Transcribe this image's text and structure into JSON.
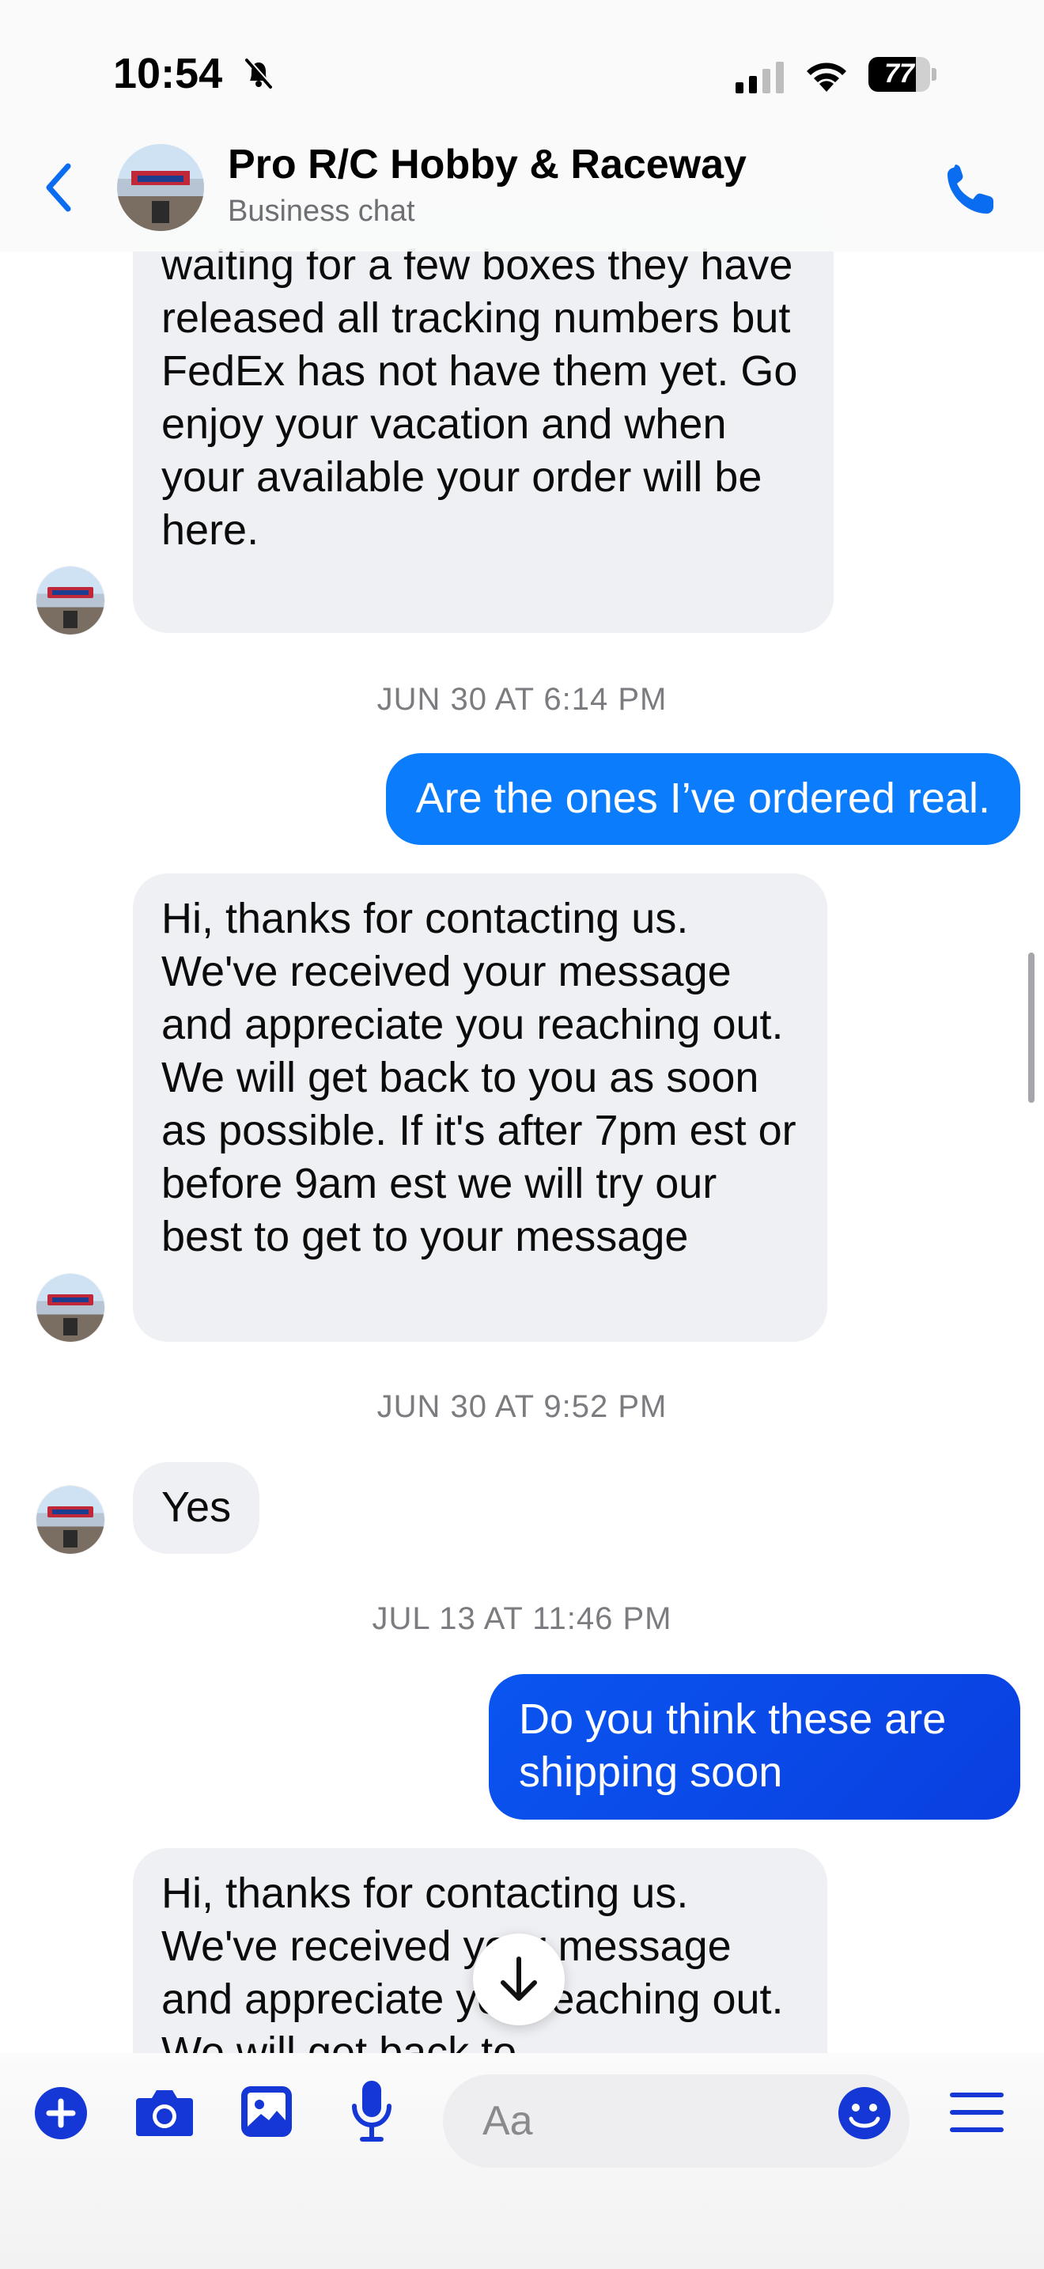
{
  "status_bar": {
    "time": "10:54",
    "battery": "77"
  },
  "header": {
    "title": "Pro R/C Hobby & Raceway",
    "subtitle": "Business chat"
  },
  "messages": [
    {
      "from": "business",
      "text": "waiting for a few boxes they have released all tracking numbers but FedEx has not have them yet. Go enjoy your vacation and when your available  your order will be here."
    },
    {
      "timestamp": "JUN 30 AT 6:14 PM"
    },
    {
      "from": "me",
      "text": "Are the ones I’ve ordered real."
    },
    {
      "from": "business",
      "text": "Hi, thanks for contacting us. We've received your message and appreciate you reaching out. We will get back to you as soon as possible. If it's after 7pm est or before 9am est we will try our best to get to your message"
    },
    {
      "timestamp": "JUN 30 AT 9:52 PM"
    },
    {
      "from": "business",
      "text": "Yes"
    },
    {
      "timestamp": "JUL 13 AT 11:46 PM"
    },
    {
      "from": "me",
      "text": "Do you think these are shipping soon"
    },
    {
      "from": "business",
      "text": "Hi, thanks for contacting us. We've received your message and appreciate you reaching out. We will get back to"
    }
  ],
  "composer": {
    "placeholder": "Aa"
  },
  "colors": {
    "accent": "#0a6cf0",
    "outgoing_bubble_light": "#0b84ff",
    "outgoing_bubble_dark": "#0a3fe0",
    "incoming_bubble": "#eff0f4",
    "icon_blue": "#1437d6"
  },
  "icons": [
    "bell-slash-icon",
    "signal-icon",
    "wifi-icon",
    "battery-icon",
    "back-chevron-icon",
    "phone-icon",
    "plus-icon",
    "camera-icon",
    "photo-icon",
    "microphone-icon",
    "emoji-icon",
    "menu-icon",
    "arrow-down-icon"
  ]
}
